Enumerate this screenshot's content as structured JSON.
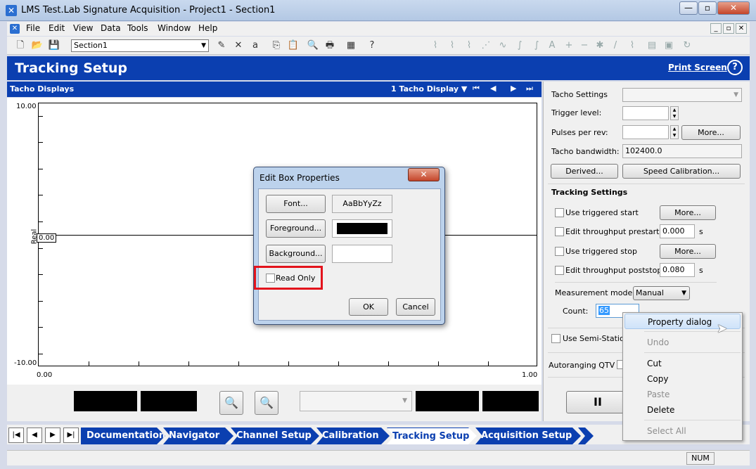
{
  "window": {
    "title": "LMS Test.Lab Signature Acquisition - Project1 - Section1"
  },
  "menu": [
    "File",
    "Edit",
    "View",
    "Data",
    "Tools",
    "Window",
    "Help"
  ],
  "toolbar": {
    "section": "Section1"
  },
  "header": {
    "title": "Tracking Setup",
    "print_screen": "Print Screen",
    "help": "?"
  },
  "display": {
    "title": "Tacho Displays",
    "count_label": "1 Tacho Display",
    "y_top": "10.00",
    "y_bottom": "-10.00",
    "y_label": "Real",
    "x_left": "0.00",
    "x_right": "1.00",
    "cursor_value": "0.00"
  },
  "tacho": {
    "settings_label": "Tacho Settings",
    "trigger_label": "Trigger level:",
    "pulses_label": "Pulses per rev:",
    "more_label": "More...",
    "bandwidth_label": "Tacho bandwidth:",
    "bandwidth_value": "102400.0",
    "derived_label": "Derived...",
    "speed_cal_label": "Speed Calibration..."
  },
  "tracking": {
    "title": "Tracking Settings",
    "use_triggered_start": "Use triggered start",
    "edit_prestart": "Edit throughput prestart",
    "prestart_value": "0.000",
    "use_triggered_stop": "Use triggered stop",
    "edit_poststop": "Edit throughput poststop",
    "poststop_value": "0.080",
    "unit_s": "s",
    "measurement_mode_label": "Measurement mode:",
    "measurement_mode_value": "Manual",
    "count_label": "Count:",
    "count_value": "65",
    "semi_stationary": "Use Semi-Stationa",
    "autoranging": "Autoranging QTV",
    "pause_label": "II"
  },
  "dialog": {
    "title": "Edit Box Properties",
    "close": "✕",
    "font_btn": "Font...",
    "font_sample": "AaBbYyZz",
    "foreground_btn": "Foreground...",
    "background_btn": "Background...",
    "read_only": "Read Only",
    "ok": "OK",
    "cancel": "Cancel",
    "foreground_color": "#000000",
    "background_color": "#ffffff"
  },
  "context_menu": {
    "property_dialog": "Property dialog",
    "undo": "Undo",
    "cut": "Cut",
    "copy": "Copy",
    "paste": "Paste",
    "delete": "Delete",
    "select_all": "Select All"
  },
  "steps": [
    "Documentation",
    "Navigator",
    "Channel Setup",
    "Calibration",
    "Tracking Setup",
    "Acquisition Setup"
  ],
  "status": {
    "num": "NUM"
  },
  "colors": {
    "accent": "#0b3fb0",
    "highlight_red": "#e3131c"
  }
}
